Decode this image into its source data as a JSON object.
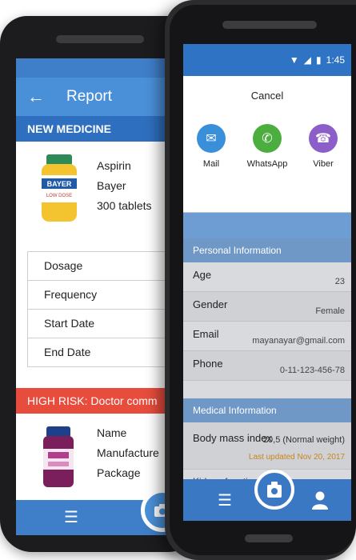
{
  "colors": {
    "primary": "#4a90d9",
    "section": "#2f6fbf",
    "alert": "#e74c3c",
    "mail": "#3a8fd9",
    "whatsapp": "#4cae3f",
    "viber": "#8b5ec9",
    "updated": "#c8861e"
  },
  "left_phone": {
    "appbar": {
      "back_icon": "arrow-left-icon",
      "title": "Report"
    },
    "section_new": "NEW MEDICINE",
    "medicine1": {
      "name": "Aspirin",
      "brand": "Bayer",
      "package": "300 tablets",
      "image_label": "BAYER",
      "image_sub": "LOW DOSE"
    },
    "table": [
      {
        "label": "Dosage"
      },
      {
        "label": "Frequency"
      },
      {
        "label": "Start Date"
      },
      {
        "label": "End Date"
      }
    ],
    "alert": "HIGH RISK: Doctor comm",
    "medicine2": {
      "name": "Name",
      "manufacturer": "Manufacture",
      "package": "Package"
    },
    "bottom_nav": {
      "list_icon": "list-icon",
      "camera_icon": "camera-icon"
    }
  },
  "right_phone": {
    "status": {
      "time": "1:45"
    },
    "share_sheet": {
      "cancel": "Cancel",
      "apps": [
        {
          "label": "Mail",
          "icon": "mail-icon",
          "color": "#3a8fd9"
        },
        {
          "label": "WhatsApp",
          "icon": "whatsapp-icon",
          "color": "#4cae3f"
        },
        {
          "label": "Viber",
          "icon": "viber-icon",
          "color": "#8b5ec9"
        }
      ]
    },
    "personal": {
      "title": "Personal Information",
      "rows": [
        {
          "label": "Age",
          "value": "23"
        },
        {
          "label": "Gender",
          "value": "Female"
        },
        {
          "label": "Email",
          "value": "mayanayar@gmail.com"
        },
        {
          "label": "Phone",
          "value": "0-11-123-456-78"
        }
      ]
    },
    "medical": {
      "title": "Medical Information",
      "bmi": {
        "label": "Body mass index",
        "value": "20,5 (Normal weight)",
        "updated": "Last updated Nov 20, 2017"
      },
      "peek": "Kidney function"
    },
    "bottom_nav": {
      "list_icon": "list-icon",
      "camera_icon": "camera-icon",
      "user_icon": "user-icon"
    }
  }
}
